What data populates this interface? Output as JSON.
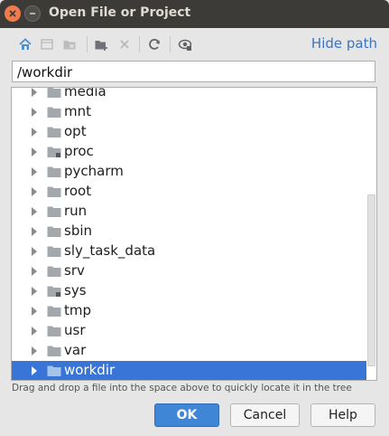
{
  "window": {
    "title": "Open File or Project"
  },
  "toolbar": {
    "icons": [
      "home-icon",
      "desktop-icon",
      "project-folder-icon",
      "new-folder-icon",
      "delete-icon",
      "refresh-icon",
      "show-hidden-icon"
    ],
    "hide_path_label": "Hide path"
  },
  "path_field": {
    "value": "/workdir"
  },
  "tree": {
    "items": [
      {
        "label": "media",
        "locked": false,
        "selected": false
      },
      {
        "label": "mnt",
        "locked": false,
        "selected": false
      },
      {
        "label": "opt",
        "locked": false,
        "selected": false
      },
      {
        "label": "proc",
        "locked": true,
        "selected": false
      },
      {
        "label": "pycharm",
        "locked": false,
        "selected": false
      },
      {
        "label": "root",
        "locked": false,
        "selected": false
      },
      {
        "label": "run",
        "locked": false,
        "selected": false
      },
      {
        "label": "sbin",
        "locked": false,
        "selected": false
      },
      {
        "label": "sly_task_data",
        "locked": false,
        "selected": false
      },
      {
        "label": "srv",
        "locked": false,
        "selected": false
      },
      {
        "label": "sys",
        "locked": true,
        "selected": false
      },
      {
        "label": "tmp",
        "locked": false,
        "selected": false
      },
      {
        "label": "usr",
        "locked": false,
        "selected": false
      },
      {
        "label": "var",
        "locked": false,
        "selected": false
      },
      {
        "label": "workdir",
        "locked": false,
        "selected": true
      }
    ]
  },
  "hint": "Drag and drop a file into the space above to quickly locate it in the tree",
  "buttons": {
    "ok": "OK",
    "cancel": "Cancel",
    "help": "Help"
  },
  "colors": {
    "accent": "#3875d7",
    "link": "#3a74c4",
    "titlebar": "#3c3b37",
    "close_button": "#ef7a4c"
  }
}
